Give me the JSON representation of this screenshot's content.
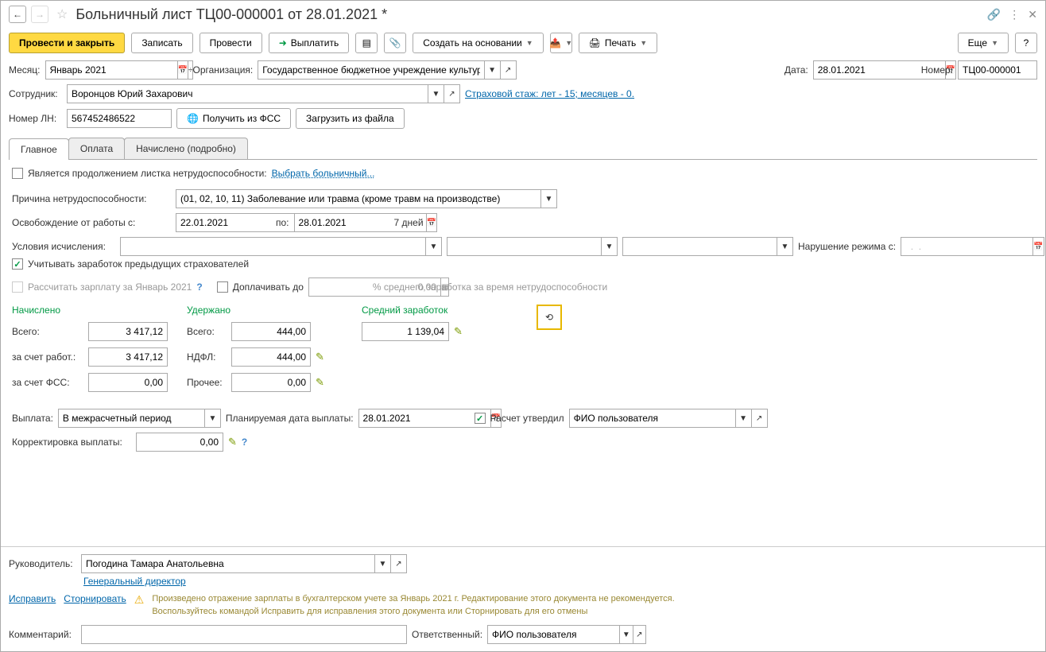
{
  "title": "Больничный лист ТЦ00-000001 от 28.01.2021 *",
  "toolbar": {
    "post_close": "Провести и закрыть",
    "save": "Записать",
    "post": "Провести",
    "pay": "Выплатить",
    "create_based": "Создать на основании",
    "print": "Печать",
    "more": "Еще",
    "help": "?"
  },
  "labels": {
    "month": "Месяц:",
    "org": "Организация:",
    "date": "Дата:",
    "number": "Номер:",
    "employee": "Сотрудник:",
    "ln_number": "Номер ЛН:",
    "get_fss": "Получить из ФСС",
    "load_file": "Загрузить из файла",
    "insurance_link": "Страховой стаж: лет - 15; месяцев - 0.",
    "is_continuation": "Является продолжением листка нетрудоспособности:",
    "choose_sickleave": "Выбрать больничный...",
    "reason": "Причина нетрудоспособности:",
    "release_from": "Освобождение от работы с:",
    "release_to": "по:",
    "days": "7 дней",
    "calc_cond": "Условия исчисления:",
    "violation": "Нарушение режима с:",
    "prev_insurers": "Учитывать заработок предыдущих страхователей",
    "calc_salary": "Рассчитать зарплату за Январь 2021",
    "topup_to": "Доплачивать до",
    "topup_val": "0,00",
    "pct_text": "% среднего заработка за время нетрудоспособности",
    "accrued": "Начислено",
    "withheld": "Удержано",
    "avg_earn": "Средний заработок",
    "total": "Всего:",
    "by_employer": "за счет работ.:",
    "by_fss": "за счет ФСС:",
    "ndfl": "НДФЛ:",
    "other": "Прочее:",
    "payout": "Выплата:",
    "planned_date": "Планируемая дата выплаты:",
    "calc_approved": "Расчет утвердил",
    "correction": "Корректировка выплаты:",
    "manager": "Руководитель:",
    "manager_pos": "Генеральный директор",
    "fix": "Исправить",
    "reverse": "Сторнировать",
    "warn1": "Произведено отражение зарплаты в бухгалтерском учете за Январь 2021 г. Редактирование этого документа не рекомендуется.",
    "warn2": "Воспользуйтесь командой Исправить для исправления этого документа или Сторнировать для его отмены",
    "comment": "Комментарий:",
    "responsible": "Ответственный:"
  },
  "values": {
    "month": "Январь 2021",
    "org": "Государственное бюджетное учреждение культуры \"Театральный центр\"",
    "date": "28.01.2021",
    "number": "ТЦ00-000001",
    "employee": "Воронцов Юрий Захарович",
    "ln_number": "567452486522",
    "reason": "(01, 02, 10, 11) Заболевание или травма (кроме травм на производстве)",
    "date_from": "22.01.2021",
    "date_to": "28.01.2021",
    "violation_date": "  .  .    ",
    "accrued_total": "3 417,12",
    "accrued_emp": "3 417,12",
    "accrued_fss": "0,00",
    "withheld_total": "444,00",
    "withheld_ndfl": "444,00",
    "withheld_other": "0,00",
    "avg_earn": "1 139,04",
    "payout": "В межрасчетный период",
    "planned_date": "28.01.2021",
    "approver": "ФИО пользователя",
    "correction": "0,00",
    "manager": "Погодина Тамара Анатольевна",
    "responsible": "ФИО пользователя"
  },
  "tabs": {
    "main": "Главное",
    "payment": "Оплата",
    "accrued": "Начислено (подробно)"
  }
}
